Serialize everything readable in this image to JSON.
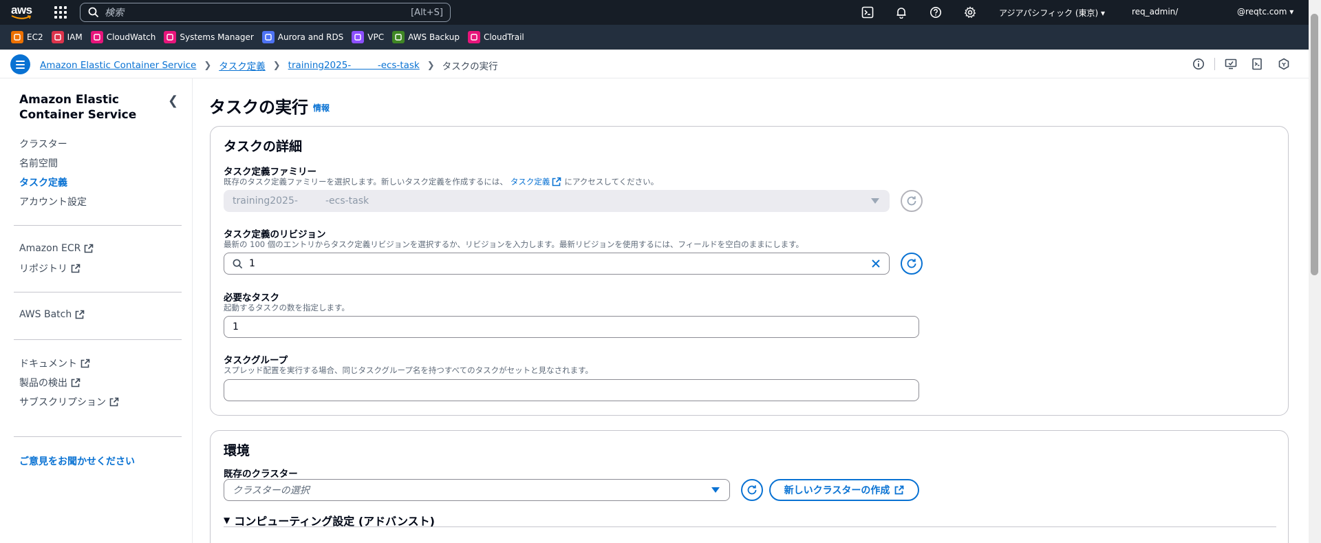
{
  "topbar": {
    "logo_text": "aws",
    "search_placeholder": "検索",
    "search_shortcut": "[Alt+S]",
    "region": "アジアパシフィック (東京)",
    "account": "req_admin/",
    "user": "@reqtc.com"
  },
  "favorites": [
    {
      "label": "EC2",
      "color": "#ed7100"
    },
    {
      "label": "IAM",
      "color": "#dd344c"
    },
    {
      "label": "CloudWatch",
      "color": "#e7157b"
    },
    {
      "label": "Systems Manager",
      "color": "#e7157b"
    },
    {
      "label": "Aurora and RDS",
      "color": "#4d72f3"
    },
    {
      "label": "VPC",
      "color": "#8c4fff"
    },
    {
      "label": "AWS Backup",
      "color": "#3f8624"
    },
    {
      "label": "CloudTrail",
      "color": "#e7157b"
    }
  ],
  "breadcrumb": {
    "items": [
      "Amazon Elastic Container Service",
      "タスク定義",
      "training2025-         -ecs-task"
    ],
    "current": "タスクの実行"
  },
  "sidebar": {
    "title": "Amazon Elastic Container Service",
    "items": [
      "クラスター",
      "名前空間",
      "タスク定義",
      "アカウント設定"
    ],
    "active": "タスク定義",
    "links1": [
      "Amazon ECR",
      "リポジトリ"
    ],
    "links2": [
      "AWS Batch"
    ],
    "links3": [
      "ドキュメント",
      "製品の検出",
      "サブスクリプション"
    ],
    "feedback": "ご意見をお聞かせください"
  },
  "page": {
    "title": "タスクの実行",
    "info": "情報"
  },
  "task_details": {
    "header": "タスクの詳細",
    "family_label": "タスク定義ファミリー",
    "family_desc_pre": "既存のタスク定義ファミリーを選択します。新しいタスク定義を作成するには、",
    "family_desc_link": "タスク定義",
    "family_desc_post": "にアクセスしてください。",
    "family_value": "training2025-         -ecs-task",
    "revision_label": "タスク定義のリビジョン",
    "revision_desc": "最新の 100 個のエントリからタスク定義リビジョンを選択するか、リビジョンを入力します。最新リビジョンを使用するには、フィールドを空白のままにします。",
    "revision_value": "1",
    "desired_label": "必要なタスク",
    "desired_desc": "起動するタスクの数を指定します。",
    "desired_value": "1",
    "group_label": "タスクグループ",
    "group_desc": "スプレッド配置を実行する場合、同じタスクグループ名を持つすべてのタスクがセットと見なされます。",
    "group_value": ""
  },
  "environment": {
    "header": "環境",
    "cluster_label": "既存のクラスター",
    "cluster_placeholder": "クラスターの選択",
    "create_cluster": "新しいクラスターの作成",
    "compute_expander": "コンピューティング設定 (アドバンスト)"
  }
}
